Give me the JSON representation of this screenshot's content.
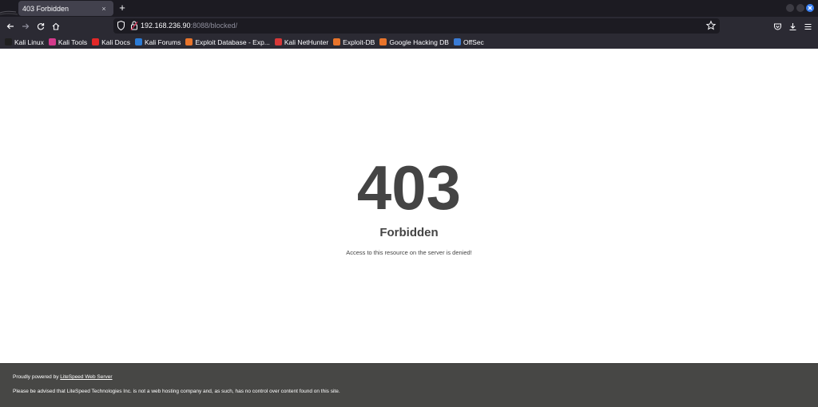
{
  "browser": {
    "tab": {
      "title": "403 Forbidden",
      "close": "×"
    },
    "new_tab": "+",
    "url": {
      "host": "192.168.236.90",
      "path": ":8088/blocked/"
    },
    "bookmarks": [
      {
        "label": "Kali Linux",
        "icon_color": "#1f1f1f"
      },
      {
        "label": "Kali Tools",
        "icon_color": "#d33a8c"
      },
      {
        "label": "Kali Docs",
        "icon_color": "#e22828"
      },
      {
        "label": "Kali Forums",
        "icon_color": "#2b7bd6"
      },
      {
        "label": "Exploit Database - Exp...",
        "icon_color": "#e8742b"
      },
      {
        "label": "Kali NetHunter",
        "icon_color": "#d73838"
      },
      {
        "label": "Exploit-DB",
        "icon_color": "#e8742b"
      },
      {
        "label": "Google Hacking DB",
        "icon_color": "#e8742b"
      },
      {
        "label": "OffSec",
        "icon_color": "#3a7bd5"
      }
    ],
    "colors": {
      "tabstrip": "#1c1b22",
      "toolbar": "#2b2a33",
      "accent": "#3b82f6"
    }
  },
  "page": {
    "code": "403",
    "heading": "Forbidden",
    "message": "Access to this resource on the server is denied!",
    "text_color": "#444444"
  },
  "footer": {
    "powered_prefix": "Proudly powered by",
    "powered_link": "LiteSpeed Web Server",
    "disclaimer": "Please be advised that LiteSpeed Technologies Inc. is not a web hosting company and, as such, has no control over content found on this site.",
    "bg_color": "#474745"
  }
}
